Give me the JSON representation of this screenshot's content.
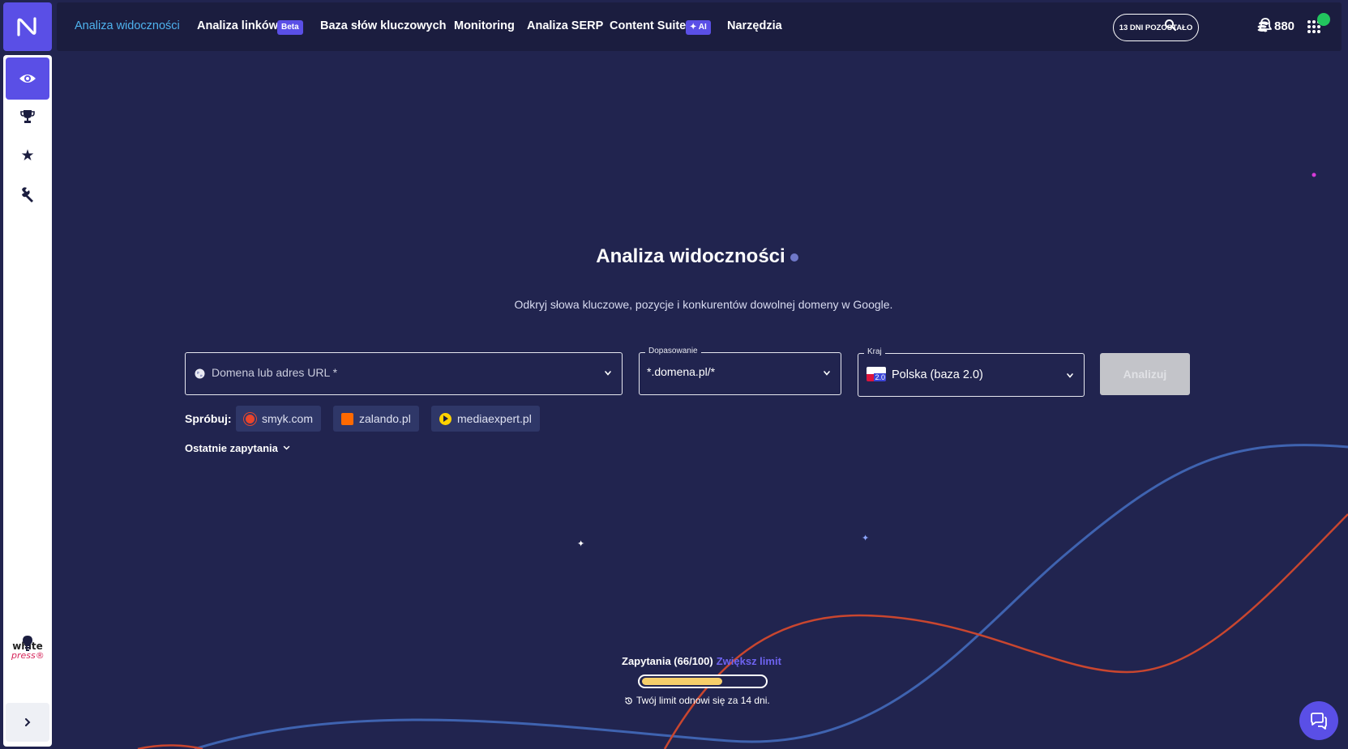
{
  "nav": {
    "items": [
      {
        "label": "Analiza widoczności",
        "active": true
      },
      {
        "label": "Analiza linków",
        "badge": "Beta"
      },
      {
        "label": "Baza słów kluczowych"
      },
      {
        "label": "Monitoring"
      },
      {
        "label": "Analiza SERP"
      },
      {
        "label": "Content Suite",
        "badge": "AI"
      },
      {
        "label": "Narzędzia"
      }
    ],
    "trial_label": "13 DNI POZOSTAŁO",
    "credits": "880"
  },
  "sidebar": {
    "items": [
      {
        "icon": "eye-icon",
        "active": true
      },
      {
        "icon": "trophy-icon"
      },
      {
        "icon": "star-icon"
      },
      {
        "icon": "wrench-icon"
      }
    ],
    "partner_logo": {
      "line1": "white",
      "line2": "press®"
    },
    "bottom_icons": [
      "lightbulb-icon",
      "chevron-right-icon"
    ]
  },
  "main": {
    "title": "Analiza widoczności",
    "subtitle": "Odkryj słowa kluczowe, pozycje i konkurentów dowolnej domeny w Google.",
    "domain_input": {
      "placeholder": "Domena lub adres URL *"
    },
    "match_select": {
      "legend": "Dopasowanie",
      "value": "*.domena.pl/*"
    },
    "country_select": {
      "legend": "Kraj",
      "value": "Polska (baza 2.0)",
      "flag_badge": "2.0"
    },
    "analyze_button": "Analizuj",
    "try_label": "Spróbuj:",
    "suggestions": [
      {
        "label": "smyk.com",
        "color": "#e8452c"
      },
      {
        "label": "zalando.pl",
        "color": "#ff6900"
      },
      {
        "label": "mediaexpert.pl",
        "color": "#ffd200"
      }
    ],
    "recent_label": "Ostatnie zapytania",
    "quota": {
      "label": "Zapytania (66/100)",
      "used": 66,
      "total": 100,
      "link": "Zwiększ limit",
      "renew_text": "Twój limit odnowi się za 14 dni."
    }
  },
  "colors": {
    "background": "#21244f",
    "topbar": "#1b1d3f",
    "accent": "#5a4fe6",
    "active_nav": "#4fb3ee",
    "progress": "#f6cf6a",
    "curve_blue": "#3f63b0",
    "curve_red": "#c9462f"
  }
}
